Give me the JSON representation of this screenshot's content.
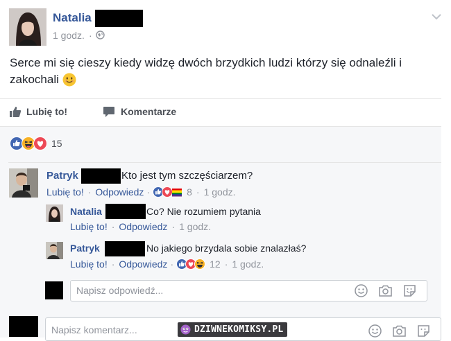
{
  "post": {
    "author": "Natalia",
    "time": "1 godz.",
    "sep": "·",
    "text_line1": "Serce mi się cieszy kiedy widzę dwóch brzydkich ludzi którzy się odnaleźli i",
    "text_line2": "zakochali",
    "emoji": "smiling-face"
  },
  "actions": {
    "like_label": "Lubię to!",
    "comment_label": "Komentarze"
  },
  "reactions": {
    "types": [
      "like",
      "haha",
      "love"
    ],
    "count": "15"
  },
  "comments": [
    {
      "author": "Patryk",
      "text": "Kto jest tym szczęściarzem?",
      "like_label": "Lubię to!",
      "reply_label": "Odpowiedz",
      "reaction_types": [
        "like",
        "love",
        "pride"
      ],
      "reaction_count": "8",
      "time": "1 godz."
    }
  ],
  "replies": [
    {
      "author": "Natalia",
      "text": "Co? Nie rozumiem pytania",
      "like_label": "Lubię to!",
      "reply_label": "Odpowiedz",
      "time": "1 godz."
    },
    {
      "author": "Patryk",
      "text": "No jakiego brzydala sobie znalazłaś?",
      "like_label": "Lubię to!",
      "reply_label": "Odpowiedz",
      "reaction_types": [
        "like",
        "love",
        "haha"
      ],
      "reaction_count": "12",
      "time": "1 godz."
    }
  ],
  "reply_box": {
    "placeholder": "Napisz odpowiedź..."
  },
  "comment_box": {
    "placeholder": "Napisz komentarz..."
  },
  "watermark": {
    "text": "DZIWNEKOMIKSY.PL"
  },
  "colors": {
    "link": "#365899",
    "like": "#4267b2",
    "love": "#ed4956",
    "haha": "#f7b125",
    "muted": "#90949c"
  }
}
